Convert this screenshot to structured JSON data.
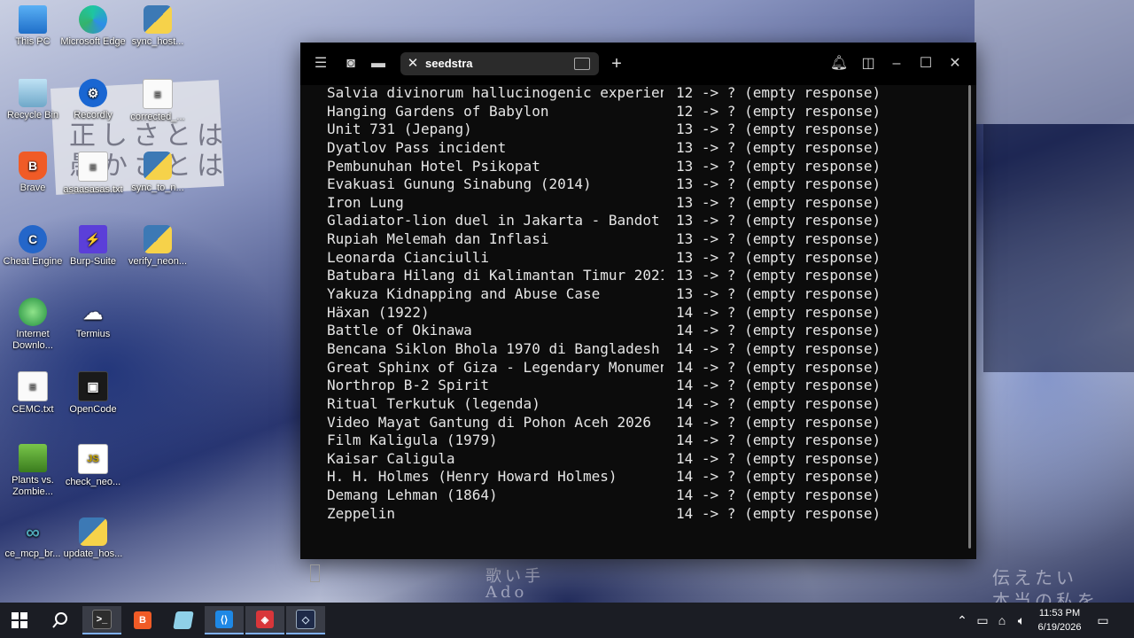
{
  "desktop_icons": [
    {
      "label": "This PC",
      "icon": "this-pc-icon"
    },
    {
      "label": "Microsoft Edge",
      "icon": "edge-icon"
    },
    {
      "label": "sync_host...",
      "icon": "python-file-icon"
    },
    {
      "label": "Recycle Bin",
      "icon": "recycle-bin-icon"
    },
    {
      "label": "Recordly",
      "icon": "recordly-icon"
    },
    {
      "label": "corrected_...",
      "icon": "document-icon"
    },
    {
      "label": "Brave",
      "icon": "brave-icon"
    },
    {
      "label": "asaasasas.txt",
      "icon": "text-file-icon"
    },
    {
      "label": "sync_to_n...",
      "icon": "python-file-icon"
    },
    {
      "label": "Cheat Engine",
      "icon": "cheat-engine-icon"
    },
    {
      "label": "Burp-Suite",
      "icon": "burp-suite-icon"
    },
    {
      "label": "verify_neon...",
      "icon": "python-file-icon"
    },
    {
      "label": "Internet Downlo...",
      "icon": "idm-icon"
    },
    {
      "label": "Termius",
      "icon": "termius-icon"
    },
    {
      "label": "CEMC.txt",
      "icon": "text-file-icon"
    },
    {
      "label": "OpenCode",
      "icon": "opencode-icon"
    },
    {
      "label": "Plants vs. Zombie...",
      "icon": "pvz-icon"
    },
    {
      "label": "check_neo...",
      "icon": "js-file-icon"
    },
    {
      "label": "ce_mcp_br...",
      "icon": "mcp-icon"
    },
    {
      "label": "update_hos...",
      "icon": "python-file-icon"
    }
  ],
  "wallpaper": {
    "jp_text_1": "正しさとは",
    "jp_text_2": "愚かさとは",
    "jp_text_3": "歌い手",
    "jp_text_4": "Ado",
    "jp_text_5": "伝えたい",
    "jp_text_6": "本当の私を"
  },
  "terminal": {
    "tab_title": "seedstra",
    "rows": [
      {
        "title": "Salvia divinorum hallucinogenic experien",
        "status": "12 -> ? (empty response)"
      },
      {
        "title": "Hanging Gardens of Babylon",
        "status": "12 -> ? (empty response)"
      },
      {
        "title": "Unit 731 (Jepang)",
        "status": "13 -> ? (empty response)"
      },
      {
        "title": "Dyatlov Pass incident",
        "status": "13 -> ? (empty response)"
      },
      {
        "title": "Pembunuhan Hotel Psikopat",
        "status": "13 -> ? (empty response)"
      },
      {
        "title": "Evakuasi Gunung Sinabung (2014)",
        "status": "13 -> ? (empty response)"
      },
      {
        "title": "Iron Lung",
        "status": "13 -> ? (empty response)"
      },
      {
        "title": "Gladiator-lion duel in Jakarta - Bandot",
        "status": "13 -> ? (empty response)"
      },
      {
        "title": "Rupiah Melemah dan Inflasi",
        "status": "13 -> ? (empty response)"
      },
      {
        "title": "Leonarda Cianciulli",
        "status": "13 -> ? (empty response)"
      },
      {
        "title": "Batubara Hilang di Kalimantan Timur 2021",
        "status": "13 -> ? (empty response)"
      },
      {
        "title": "Yakuza Kidnapping and Abuse Case",
        "status": "13 -> ? (empty response)"
      },
      {
        "title": "Häxan (1922)",
        "status": "14 -> ? (empty response)"
      },
      {
        "title": "Battle of Okinawa",
        "status": "14 -> ? (empty response)"
      },
      {
        "title": "Bencana Siklon Bhola 1970 di Bangladesh",
        "status": "14 -> ? (empty response)"
      },
      {
        "title": "Great Sphinx of Giza - Legendary Monumen",
        "status": "14 -> ? (empty response)"
      },
      {
        "title": "Northrop B-2 Spirit",
        "status": "14 -> ? (empty response)"
      },
      {
        "title": "Ritual Terkutuk (legenda)",
        "status": "14 -> ? (empty response)"
      },
      {
        "title": "Video Mayat Gantung di Pohon Aceh 2026",
        "status": "14 -> ? (empty response)"
      },
      {
        "title": "Film Kaligula (1979)",
        "status": "14 -> ? (empty response)"
      },
      {
        "title": "Kaisar Caligula",
        "status": "14 -> ? (empty response)"
      },
      {
        "title": "H. H. Holmes (Henry Howard Holmes)",
        "status": "14 -> ? (empty response)"
      },
      {
        "title": "Demang Lehman (1864)",
        "status": "14 -> ? (empty response)"
      },
      {
        "title": "Zeppelin",
        "status": "14 -> ? (empty response)"
      }
    ]
  },
  "taskbar": {
    "apps": [
      "terminal-icon",
      "brave-icon",
      "notepad-icon",
      "vscode-icon",
      "app-icon",
      "opencode-icon"
    ],
    "time": "11:53 PM",
    "date": "6/19/2026"
  }
}
